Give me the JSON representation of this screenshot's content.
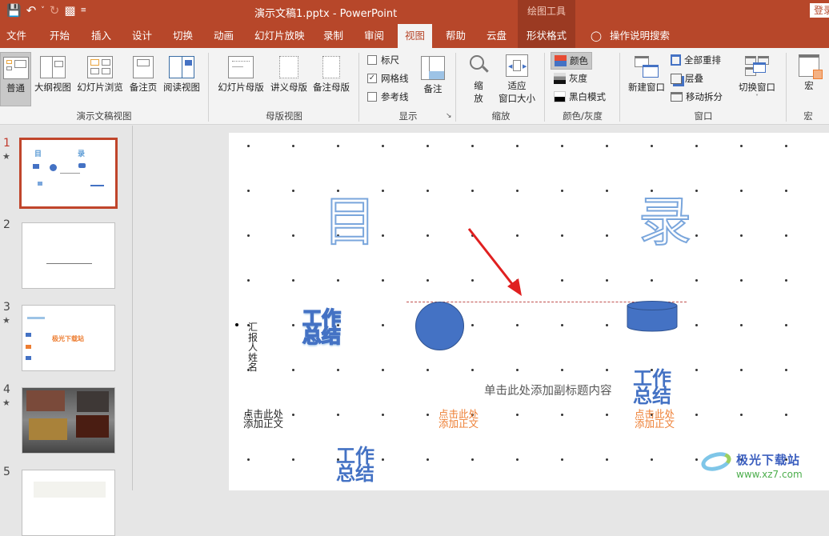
{
  "titlebar": {
    "doc_title": "演示文稿1.pptx  -  PowerPoint",
    "contextual_tools": "绘图工具",
    "login": "登录",
    "qat": {
      "save": "save-icon",
      "undo": "undo-icon",
      "redo": "redo-icon",
      "present": "present-from-start-icon",
      "customize": "customize-qat-icon"
    }
  },
  "tabs": [
    "文件",
    "开始",
    "插入",
    "设计",
    "切换",
    "动画",
    "幻灯片放映",
    "录制",
    "审阅",
    "视图",
    "帮助",
    "云盘",
    "形状格式"
  ],
  "active_tab": "视图",
  "tell_me": "操作说明搜索",
  "ribbon": {
    "presentation_views": {
      "label": "演示文稿视图",
      "buttons": [
        "普通",
        "大纲视图",
        "幻灯片浏览",
        "备注页",
        "阅读视图"
      ],
      "selected": "普通"
    },
    "master_views": {
      "label": "母版视图",
      "buttons": [
        "幻灯片母版",
        "讲义母版",
        "备注母版"
      ]
    },
    "show": {
      "label": "显示",
      "checkboxes": [
        {
          "label": "标尺",
          "checked": false
        },
        {
          "label": "网格线",
          "checked": true
        },
        {
          "label": "参考线",
          "checked": false
        }
      ],
      "notes": "备注"
    },
    "zoom": {
      "label": "缩放",
      "zoom_btn": [
        "缩",
        "放"
      ],
      "fit_btn": [
        "适应",
        "窗口大小"
      ]
    },
    "color": {
      "label": "颜色/灰度",
      "items": [
        "颜色",
        "灰度",
        "黑白模式"
      ],
      "selected": "颜色"
    },
    "window": {
      "label": "窗口",
      "new_window": "新建窗口",
      "items": [
        "全部重排",
        "层叠",
        "移动拆分"
      ],
      "switch": "切换窗口"
    },
    "macro": {
      "label": "宏",
      "button": "宏"
    }
  },
  "thumbnails": [
    {
      "num": "1",
      "star": true,
      "active": true
    },
    {
      "num": "2",
      "star": false,
      "active": false
    },
    {
      "num": "3",
      "star": true,
      "active": false,
      "text": "极光下载站"
    },
    {
      "num": "4",
      "star": true,
      "active": false
    },
    {
      "num": "5",
      "star": false,
      "active": false
    }
  ],
  "slide": {
    "char_mu": "目",
    "char_lu": "录",
    "reporter": [
      "汇报",
      "人姓",
      "名"
    ],
    "work_summary": [
      "工作",
      "总结"
    ],
    "click_add_body": [
      "点击此处",
      "添加正文"
    ],
    "subtitle_placeholder": "单击此处添加副标题内容",
    "watermark_text": "极光下载站",
    "watermark_url": "www.xz7.com",
    "colors": {
      "shape_fill": "#4472c4",
      "accent_orange": "#ed7d31",
      "arrow": "#e02020",
      "guide": "#c0504d"
    }
  }
}
